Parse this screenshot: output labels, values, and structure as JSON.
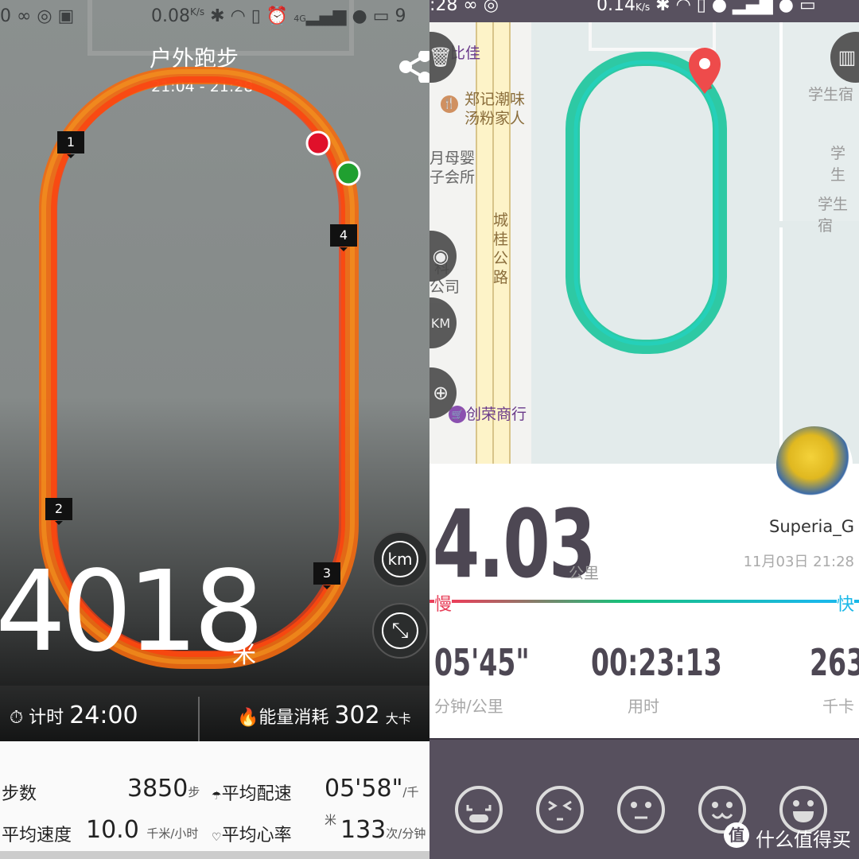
{
  "left": {
    "status_bar": {
      "left_fragment": "0",
      "speed": "0.08",
      "speed_unit": "K/s",
      "network": "4G",
      "battery_fragment": "9"
    },
    "title": "户外跑步",
    "time_range": "21:04 - 21:28",
    "km_markers": [
      "1",
      "2",
      "3",
      "4"
    ],
    "distance_value": "4018",
    "distance_unit": "米",
    "km_button": "km",
    "timer": {
      "label": "计时",
      "value": "24:00"
    },
    "energy": {
      "label": "能量消耗",
      "value": "302",
      "unit": "大卡"
    },
    "stats": [
      {
        "label": "步数",
        "value": "3850",
        "unit": "步"
      },
      {
        "label": "平均配速",
        "value": "05'58\"",
        "unit": "/千米",
        "icon": "speedometer-icon"
      },
      {
        "label": "平均速度",
        "value": "10.0",
        "unit": "千米/小时"
      },
      {
        "label": "平均心率",
        "value": "133",
        "unit": "次/分钟",
        "icon": "heart-icon"
      }
    ],
    "route_color": "#f05a10"
  },
  "right": {
    "status_bar": {
      "time_fragment": ":28",
      "speed": "0.14",
      "speed_unit": "K/s"
    },
    "map_labels": [
      "比佳",
      "郑记潮味",
      "汤粉家人",
      "月母婴",
      "子会所",
      "城",
      "桂",
      "公",
      "路",
      "科",
      "公司",
      "创荣商行",
      "学生宿",
      "学生",
      "学生宿"
    ],
    "distance_value": "4.03",
    "distance_unit": "公里",
    "user_name": "Superia_G",
    "date_time": "11月03日 21:28",
    "legend": {
      "slow": "慢",
      "fast": "快",
      "slow_color": "#e8405a",
      "fast_color": "#19b8e8"
    },
    "metrics": [
      {
        "value": "05'45\"",
        "label": "分钟/公里"
      },
      {
        "value": "00:23:13",
        "label": "用时"
      },
      {
        "value": "263",
        "label": "千卡"
      }
    ],
    "mood_faces": [
      "exhausted-face-icon",
      "squint-face-icon",
      "neutral-face-icon",
      "smile-face-icon",
      "grin-face-icon"
    ],
    "watermark": "什么值得买",
    "watermark_badge": "值",
    "route_color": "#2ec9a4"
  }
}
